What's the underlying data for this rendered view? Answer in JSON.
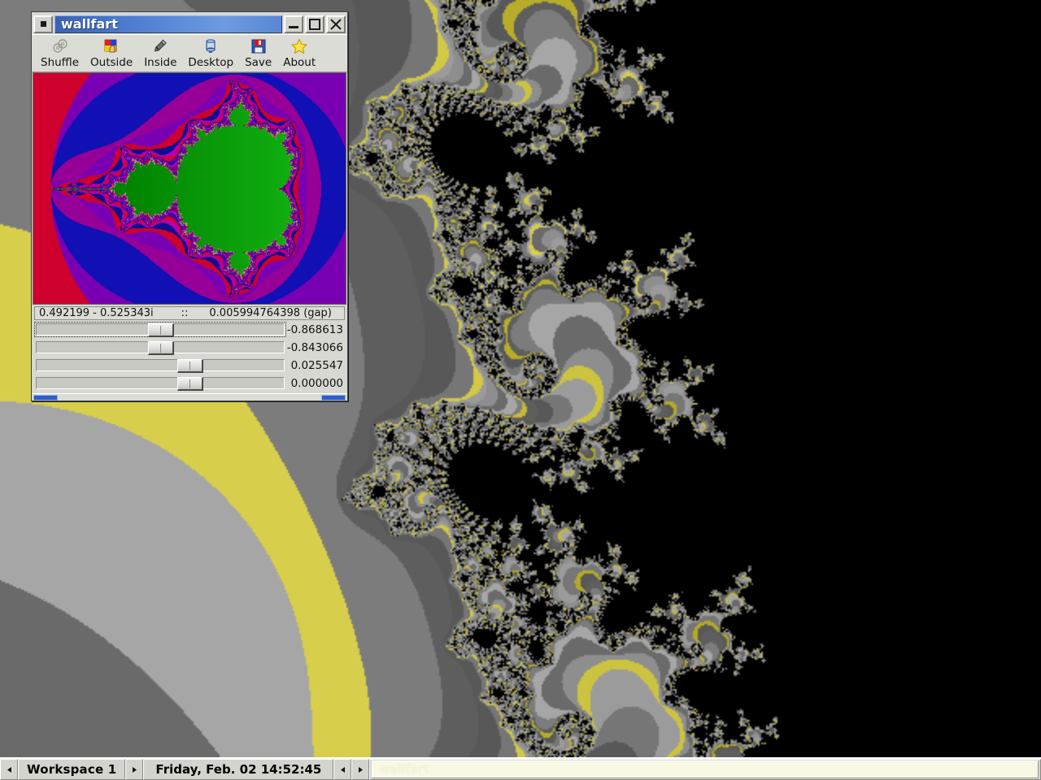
{
  "desktop": {
    "wallpaper_description": "grayscale Mandelbrot fractal tendrils over dark-olive to bright-yellow gradient",
    "colors": {
      "yellow": "#ffee00",
      "olive": "#9a8b00",
      "dark": "#1a0d06",
      "gray_light": "#9b9b9b",
      "gray_mid": "#767676",
      "gray_dark": "#585858",
      "black": "#000000"
    }
  },
  "window": {
    "title": "wallfart",
    "menu_button_icon": "window-menu-icon",
    "controls": [
      {
        "name": "minimize-button",
        "icon": "minimize-icon"
      },
      {
        "name": "maximize-button",
        "icon": "maximize-icon"
      },
      {
        "name": "close-button",
        "icon": "close-icon"
      }
    ],
    "toolbar": [
      {
        "label": "Shuffle",
        "icon": "shuffle-icon"
      },
      {
        "label": "Outside",
        "icon": "outside-palette-icon"
      },
      {
        "label": "Inside",
        "icon": "inside-eyedropper-icon"
      },
      {
        "label": "Desktop",
        "icon": "desktop-monitor-icon"
      },
      {
        "label": "Save",
        "icon": "save-floppy-icon"
      },
      {
        "label": "About",
        "icon": "about-star-icon"
      }
    ],
    "preview": {
      "description": "Mandelbrot set preview, green interior with magenta, blue, red and tan exterior bands",
      "colors": {
        "interior": "#008000",
        "interior_bright": "#13b913",
        "band_magenta": "#c000c0",
        "band_purple": "#7a00b4",
        "band_blue": "#1414e6",
        "band_red": "#e00030",
        "band_tan": "#b09a82",
        "band_orange": "#d88a3c"
      }
    },
    "info_bar": {
      "coordinate": "0.492199 - 0.525343i",
      "separator": "::",
      "gap": "0.005994764398 (gap)"
    },
    "sliders": [
      {
        "name": "slider-real",
        "value": "-0.868613",
        "position_pct": 45.0,
        "focused": true
      },
      {
        "name": "slider-imaginary",
        "value": "-0.843066",
        "position_pct": 45.0,
        "focused": false
      },
      {
        "name": "slider-zoom",
        "value": "0.025547",
        "position_pct": 57.0,
        "focused": false
      },
      {
        "name": "slider-rotation",
        "value": "0.000000",
        "position_pct": 57.0,
        "focused": false
      }
    ]
  },
  "taskbar": {
    "workspace_prev_icon": "left-arrow-icon",
    "workspace_label": "Workspace 1",
    "workspace_next_icon": "right-arrow-icon",
    "clock": "Friday, Feb. 02   14:52:45",
    "task_prev_icon": "left-arrow-icon",
    "task_next_icon": "right-arrow-icon",
    "task_button_label": "wallfart"
  }
}
